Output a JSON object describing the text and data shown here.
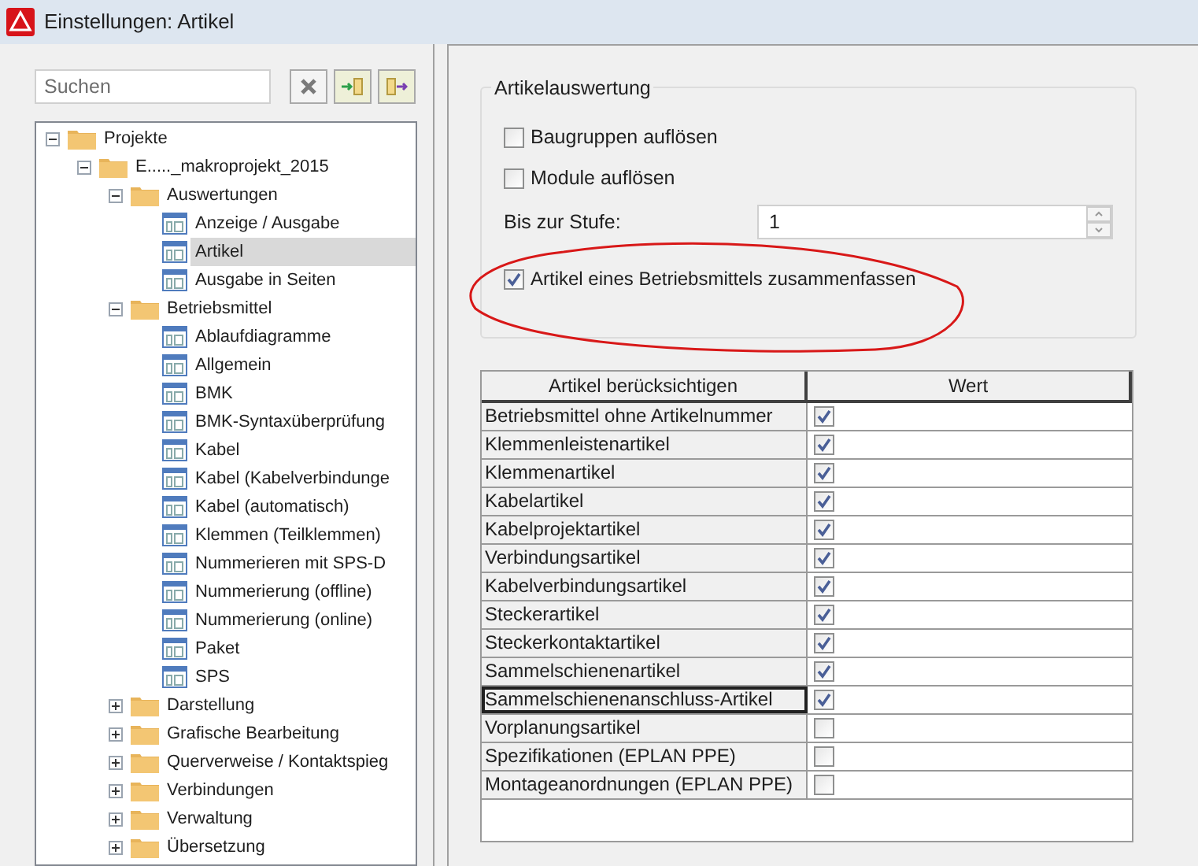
{
  "window": {
    "title": "Einstellungen: Artikel"
  },
  "search": {
    "placeholder": "Suchen"
  },
  "tree": [
    {
      "label": "Projekte",
      "kind": "folder",
      "expanded": true,
      "selected": false,
      "children": [
        {
          "label": "E....._makroprojekt_2015",
          "kind": "folder",
          "expanded": true,
          "selected": false,
          "children": [
            {
              "label": "Auswertungen",
              "kind": "folder",
              "expanded": true,
              "selected": false,
              "children": [
                {
                  "label": "Anzeige / Ausgabe",
                  "kind": "page",
                  "selected": false
                },
                {
                  "label": "Artikel",
                  "kind": "page",
                  "selected": true
                },
                {
                  "label": "Ausgabe in Seiten",
                  "kind": "page",
                  "selected": false
                }
              ]
            },
            {
              "label": "Betriebsmittel",
              "kind": "folder",
              "expanded": true,
              "selected": false,
              "children": [
                {
                  "label": "Ablaufdiagramme",
                  "kind": "page",
                  "selected": false
                },
                {
                  "label": "Allgemein",
                  "kind": "page",
                  "selected": false
                },
                {
                  "label": "BMK",
                  "kind": "page",
                  "selected": false
                },
                {
                  "label": "BMK-Syntaxüberprüfung",
                  "kind": "page",
                  "selected": false
                },
                {
                  "label": "Kabel",
                  "kind": "page",
                  "selected": false
                },
                {
                  "label": "Kabel (Kabelverbindunge",
                  "kind": "page",
                  "selected": false
                },
                {
                  "label": "Kabel (automatisch)",
                  "kind": "page",
                  "selected": false
                },
                {
                  "label": "Klemmen (Teilklemmen)",
                  "kind": "page",
                  "selected": false
                },
                {
                  "label": "Nummerieren mit SPS-D",
                  "kind": "page",
                  "selected": false
                },
                {
                  "label": "Nummerierung (offline)",
                  "kind": "page",
                  "selected": false
                },
                {
                  "label": "Nummerierung (online)",
                  "kind": "page",
                  "selected": false
                },
                {
                  "label": "Paket",
                  "kind": "page",
                  "selected": false
                },
                {
                  "label": "SPS",
                  "kind": "page",
                  "selected": false
                }
              ]
            },
            {
              "label": "Darstellung",
              "kind": "folder",
              "expanded": false,
              "selected": false
            },
            {
              "label": "Grafische Bearbeitung",
              "kind": "folder",
              "expanded": false,
              "selected": false
            },
            {
              "label": "Querverweise / Kontaktspieg",
              "kind": "folder",
              "expanded": false,
              "selected": false
            },
            {
              "label": "Verbindungen",
              "kind": "folder",
              "expanded": false,
              "selected": false
            },
            {
              "label": "Verwaltung",
              "kind": "folder",
              "expanded": false,
              "selected": false
            },
            {
              "label": "Übersetzung",
              "kind": "folder",
              "expanded": false,
              "selected": false
            }
          ]
        }
      ]
    }
  ],
  "group": {
    "title": "Artikelauswertung",
    "options": [
      {
        "label": "Baugruppen auflösen",
        "checked": false
      },
      {
        "label": "Module auflösen",
        "checked": false
      }
    ],
    "level_field": {
      "label": "Bis zur Stufe:",
      "value": "1"
    },
    "summary_option": {
      "label": "Artikel eines Betriebsmittels zusammenfassen",
      "checked": true
    }
  },
  "table": {
    "columns": [
      "Artikel berücksichtigen",
      "Wert"
    ],
    "rows": [
      {
        "label": "Betriebsmittel ohne Artikelnummer",
        "checked": true,
        "selected": false
      },
      {
        "label": "Klemmenleistenartikel",
        "checked": true,
        "selected": false
      },
      {
        "label": "Klemmenartikel",
        "checked": true,
        "selected": false
      },
      {
        "label": "Kabelartikel",
        "checked": true,
        "selected": false
      },
      {
        "label": "Kabelprojektartikel",
        "checked": true,
        "selected": false
      },
      {
        "label": "Verbindungsartikel",
        "checked": true,
        "selected": false
      },
      {
        "label": "Kabelverbindungsartikel",
        "checked": true,
        "selected": false
      },
      {
        "label": "Steckerartikel",
        "checked": true,
        "selected": false
      },
      {
        "label": "Steckerkontaktartikel",
        "checked": true,
        "selected": false
      },
      {
        "label": "Sammelschienenartikel",
        "checked": true,
        "selected": false
      },
      {
        "label": "Sammelschienenanschluss-Artikel",
        "checked": true,
        "selected": true
      },
      {
        "label": "Vorplanungsartikel",
        "checked": false,
        "selected": false
      },
      {
        "label": "Spezifikationen (EPLAN PPE)",
        "checked": false,
        "selected": false
      },
      {
        "label": "Montageanordnungen (EPLAN PPE)",
        "checked": false,
        "selected": false
      }
    ]
  }
}
